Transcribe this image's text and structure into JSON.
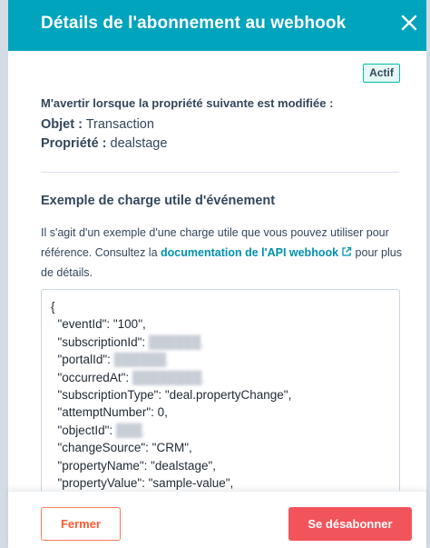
{
  "header": {
    "title": "Détails de l'abonnement au webhook"
  },
  "status": {
    "label": "Actif"
  },
  "subscription": {
    "notify_label": "M'avertir lorsque la propriété suivante est modifiée :",
    "object_key": "Objet :",
    "object_value": "Transaction",
    "property_key": "Propriété :",
    "property_value": "dealstage"
  },
  "example": {
    "title": "Exemple de charge utile d'événement",
    "description_before": "Il s'agit d'un exemple d'une charge utile que vous pouvez utiliser pour référence. Consultez la ",
    "link_text": "documentation de l'API webhook",
    "description_after": " pour plus de détails.",
    "code_lines": [
      "{",
      "  \"eventId\": \"100\",",
      "  \"subscriptionId\": ",
      "  \"portalId\": ",
      "  \"occurredAt\": ",
      "  \"subscriptionType\": \"deal.propertyChange\",",
      "  \"attemptNumber\": 0,",
      "  \"objectId\": ",
      "  \"changeSource\": \"CRM\",",
      "  \"propertyName\": \"dealstage\",",
      "  \"propertyValue\": \"sample-value\","
    ]
  },
  "footer": {
    "close_label": "Fermer",
    "unsubscribe_label": "Se désabonner"
  },
  "colors": {
    "header_bg": "#00a4bd",
    "link": "#0091ae",
    "danger": "#f2545b",
    "secondary_border": "#ff7a59"
  }
}
